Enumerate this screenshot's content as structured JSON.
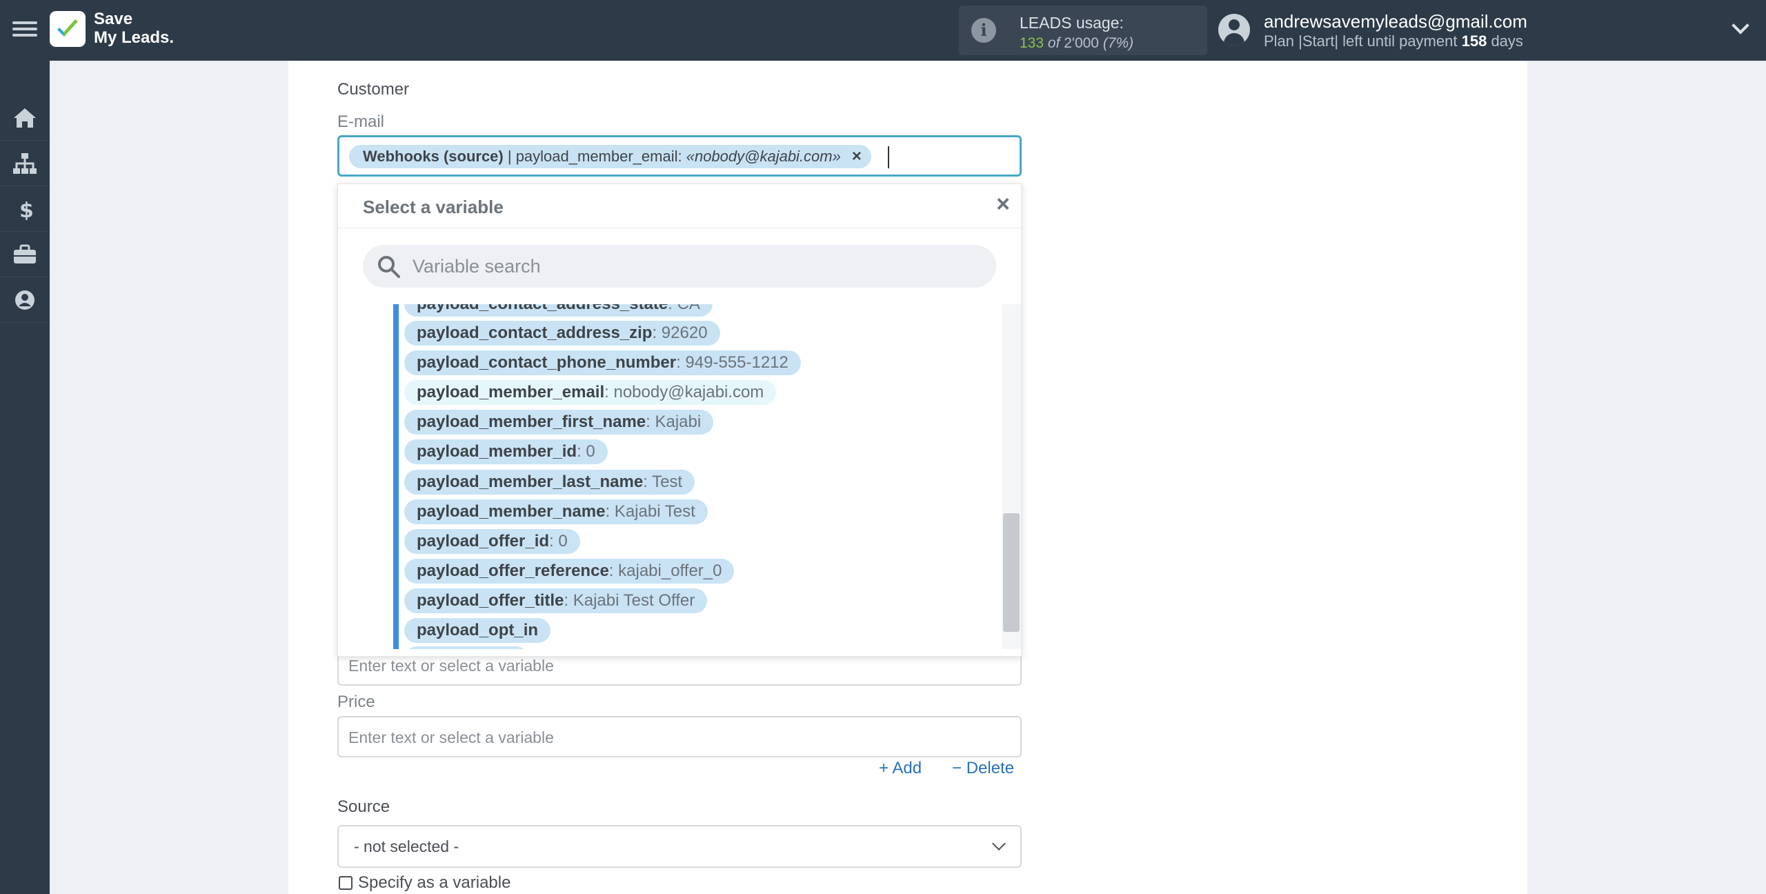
{
  "app": {
    "logo_line1": "Save",
    "logo_line2": "My Leads."
  },
  "leads_usage": {
    "label": "LEADS usage:",
    "used": "133",
    "of": "of",
    "total": "2'000",
    "percent": "(7%)"
  },
  "user": {
    "email": "andrewsavemyleads@gmail.com",
    "plan_prefix": "Plan |Start| left until payment",
    "days": "158",
    "days_suffix": "days"
  },
  "sidebar": {
    "items": [
      "home-icon",
      "sitemap-icon",
      "dollar-icon",
      "briefcase-icon",
      "user-circle-icon"
    ]
  },
  "form": {
    "section_title": "Customer",
    "email_label": "E-mail",
    "email_tag": {
      "source": "Webhooks (source)",
      "separator": " | payload_member_email: ",
      "value": "«nobody@kajabi.com»",
      "remove": "×"
    },
    "hidden_field_placeholder": "Enter text or select a variable",
    "price_label": "Price",
    "price_placeholder": "Enter text or select a variable",
    "add_label": "Add",
    "delete_label": "Delete",
    "source_label": "Source",
    "source_value": "- not selected -",
    "specify_variable_label": "Specify as a variable"
  },
  "variable_dropdown": {
    "title": "Select a variable",
    "close": "×",
    "search_placeholder": "Variable search",
    "items": [
      {
        "key": "payload_contact_address_state",
        "value": ": CA"
      },
      {
        "key": "payload_contact_address_zip",
        "value": ": 92620"
      },
      {
        "key": "payload_contact_phone_number",
        "value": ": 949-555-1212"
      },
      {
        "key": "payload_member_email",
        "value": ": nobody@kajabi.com"
      },
      {
        "key": "payload_member_first_name",
        "value": ": Kajabi"
      },
      {
        "key": "payload_member_id",
        "value": ": 0"
      },
      {
        "key": "payload_member_last_name",
        "value": ": Test"
      },
      {
        "key": "payload_member_name",
        "value": ": Kajabi Test"
      },
      {
        "key": "payload_offer_id",
        "value": ": 0"
      },
      {
        "key": "payload_offer_reference",
        "value": ": kajabi_offer_0"
      },
      {
        "key": "payload_offer_title",
        "value": ": Kajabi Test Offer"
      },
      {
        "key": "payload_opt_in",
        "value": ""
      }
    ]
  },
  "colors": {
    "topbar": "#2d3a47",
    "accent_border": "#48a7c5",
    "tag_bg": "#c9e3f5",
    "link": "#2b72b8",
    "usage_green": "#8bc34a"
  }
}
